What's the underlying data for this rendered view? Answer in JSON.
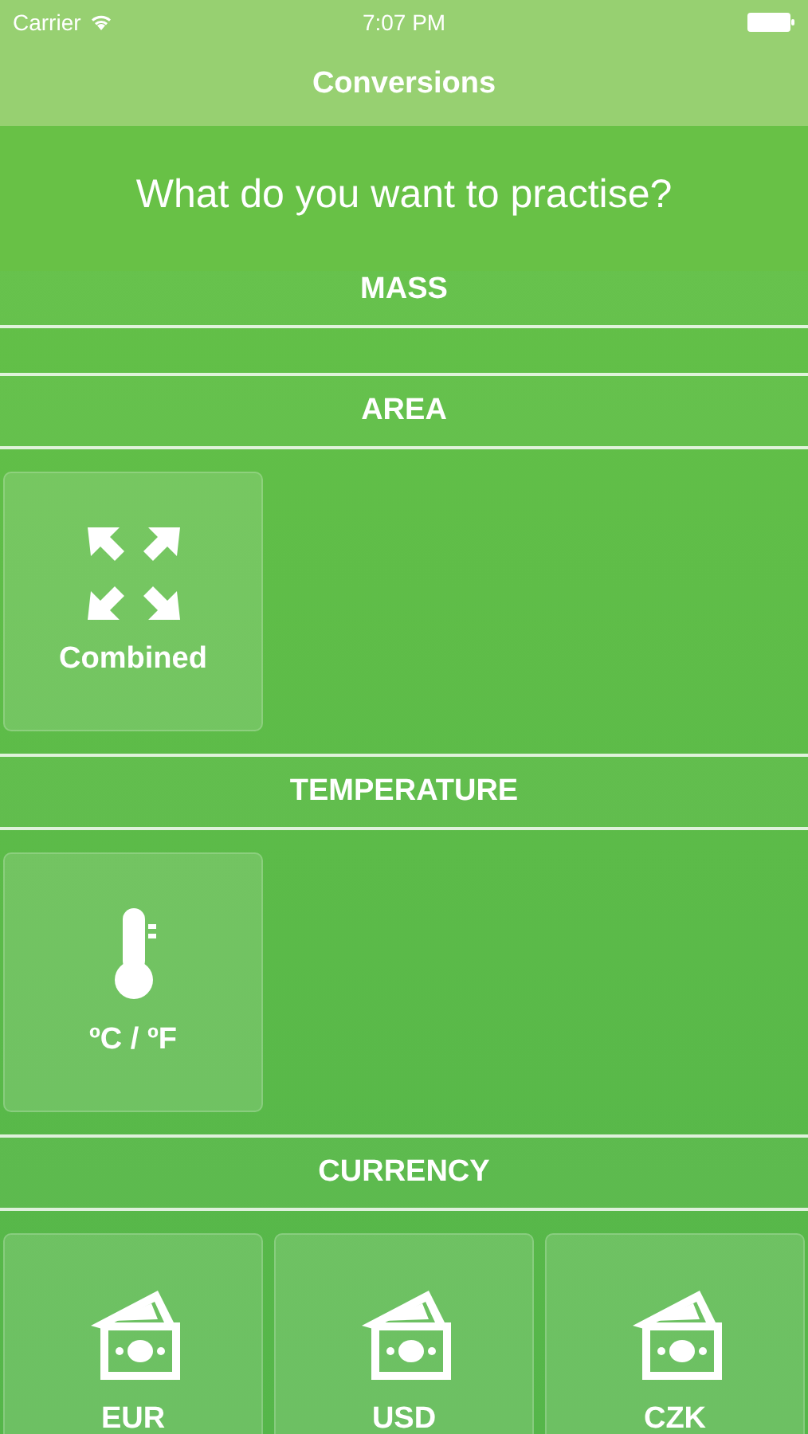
{
  "status_bar": {
    "carrier": "Carrier",
    "time": "7:07 PM"
  },
  "nav": {
    "title": "Conversions"
  },
  "prompt": "What do you want to practise?",
  "sections": [
    {
      "title": "MASS"
    },
    {
      "title": "AREA",
      "items": [
        {
          "kind": "expand",
          "label": "Combined"
        }
      ]
    },
    {
      "title": "TEMPERATURE",
      "items": [
        {
          "kind": "thermometer",
          "label": "ºC / ºF"
        }
      ]
    },
    {
      "title": "CURRENCY",
      "items": [
        {
          "kind": "money",
          "label": "EUR"
        },
        {
          "kind": "money",
          "label": "USD"
        },
        {
          "kind": "money",
          "label": "CZK"
        }
      ]
    }
  ]
}
